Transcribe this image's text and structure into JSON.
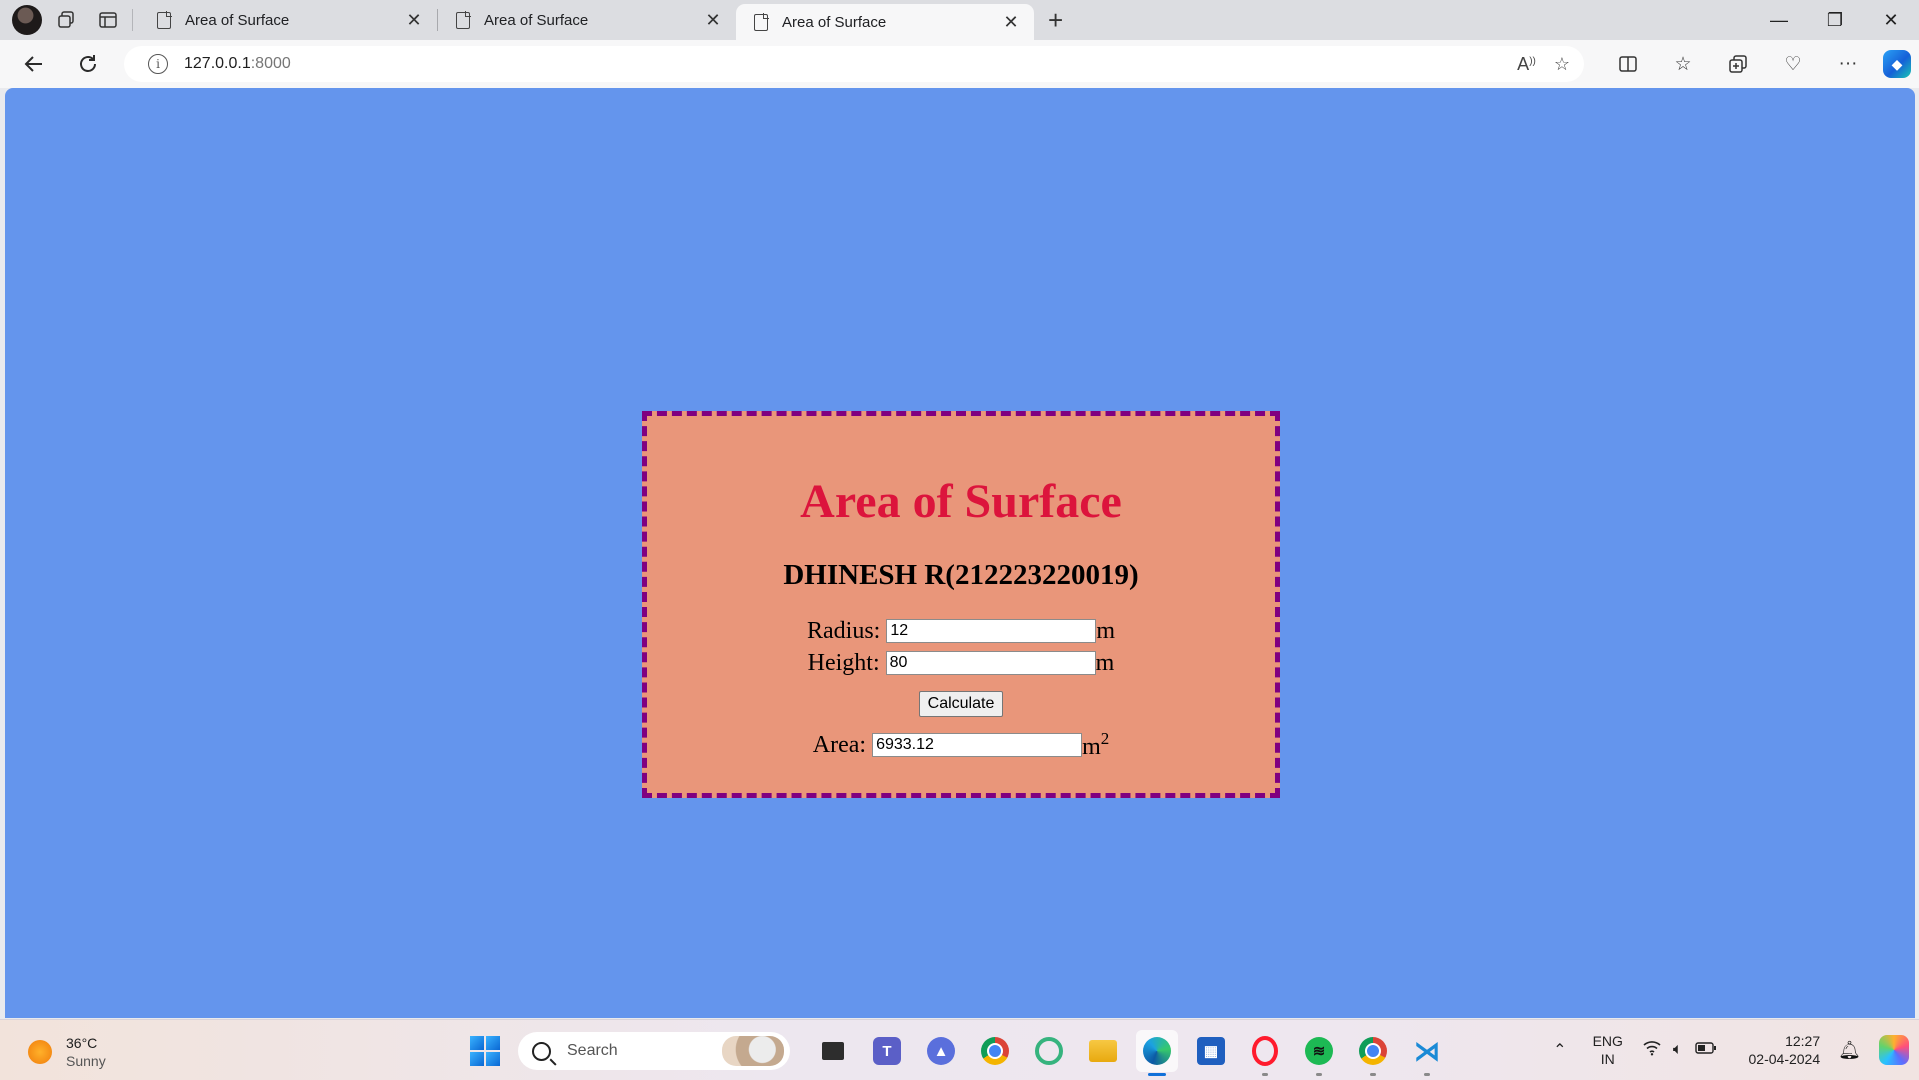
{
  "browser": {
    "tabs": [
      {
        "title": "Area of Surface",
        "active": false
      },
      {
        "title": "Area of Surface",
        "active": false
      },
      {
        "title": "Area of Surface",
        "active": true
      }
    ],
    "address": {
      "host": "127.0.0.1",
      "port": ":8000"
    }
  },
  "page": {
    "heading": "Area of Surface",
    "author": "DHINESH R(212223220019)",
    "radius": {
      "label": "Radius:",
      "value": "12",
      "unit": "m"
    },
    "height": {
      "label": "Height:",
      "value": "80",
      "unit": "m"
    },
    "calculate_label": "Calculate",
    "area": {
      "label": "Area:",
      "value": "6933.12",
      "unit": "m",
      "unit_sup": "2"
    },
    "colors": {
      "background": "#6495ed",
      "card": "#e9967a",
      "border": "#800080",
      "heading": "#dc143c"
    }
  },
  "taskbar": {
    "weather": {
      "temp": "36°C",
      "condition": "Sunny"
    },
    "search_label": "Search",
    "language": {
      "line1": "ENG",
      "line2": "IN"
    },
    "clock": {
      "time": "12:27",
      "date": "02-04-2024"
    },
    "apps": [
      "task-view",
      "teams",
      "arc",
      "chrome",
      "circle-app",
      "file-explorer",
      "edge",
      "store",
      "opera",
      "spotify",
      "chrome-profile",
      "vscode"
    ]
  }
}
